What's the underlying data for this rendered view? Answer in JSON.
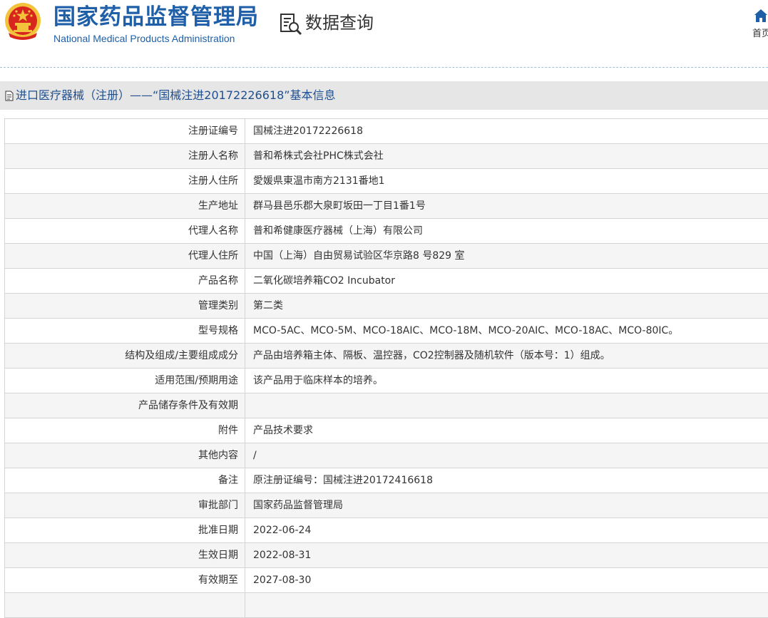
{
  "header": {
    "logo_cn": "国家药品监督管理局",
    "logo_en": "National Medical Products Administration",
    "query_title": "数据查询",
    "home_label": "首页",
    "icons": {
      "emblem": "national-emblem-icon",
      "query": "data-query-icon",
      "home": "home-icon"
    },
    "colors": {
      "brand": "#1f5fa8",
      "emblem_red": "#d7261e",
      "emblem_gold": "#f3c33c"
    }
  },
  "title_bar": {
    "icon": "document-icon",
    "text": "进口医疗器械（注册）——“国械注进20172226618”基本信息"
  },
  "records": [
    {
      "label": "注册证编号",
      "value": "国械注进20172226618"
    },
    {
      "label": "注册人名称",
      "value": "普和希株式会社PHC株式会社"
    },
    {
      "label": "注册人住所",
      "value": "愛媛県東温市南方2131番地1"
    },
    {
      "label": "生产地址",
      "value": "群马县邑乐郡大泉町坂田一丁目1番1号"
    },
    {
      "label": "代理人名称",
      "value": "普和希健康医疗器械（上海）有限公司"
    },
    {
      "label": "代理人住所",
      "value": "中国（上海）自由贸易试验区华京路8 号829 室"
    },
    {
      "label": "产品名称",
      "value": "二氧化碳培养箱CO2 Incubator"
    },
    {
      "label": "管理类别",
      "value": "第二类"
    },
    {
      "label": "型号规格",
      "value": "MCO-5AC、MCO-5M、MCO-18AIC、MCO-18M、MCO-20AIC、MCO-18AC、MCO-80IC。"
    },
    {
      "label": "结构及组成/主要组成成分",
      "value": "产品由培养箱主体、隔板、温控器，CO2控制器及随机软件（版本号：1）组成。"
    },
    {
      "label": "适用范围/预期用途",
      "value": "该产品用于临床样本的培养。"
    },
    {
      "label": "产品储存条件及有效期",
      "value": ""
    },
    {
      "label": "附件",
      "value": "产品技术要求"
    },
    {
      "label": "其他内容",
      "value": "/"
    },
    {
      "label": "备注",
      "value": "原注册证编号：国械注进20172416618"
    },
    {
      "label": "审批部门",
      "value": "国家药品监督管理局"
    },
    {
      "label": "批准日期",
      "value": "2022-06-24"
    },
    {
      "label": "生效日期",
      "value": "2022-08-31"
    },
    {
      "label": "有效期至",
      "value": "2027-08-30"
    },
    {
      "label": "",
      "value": ""
    }
  ]
}
